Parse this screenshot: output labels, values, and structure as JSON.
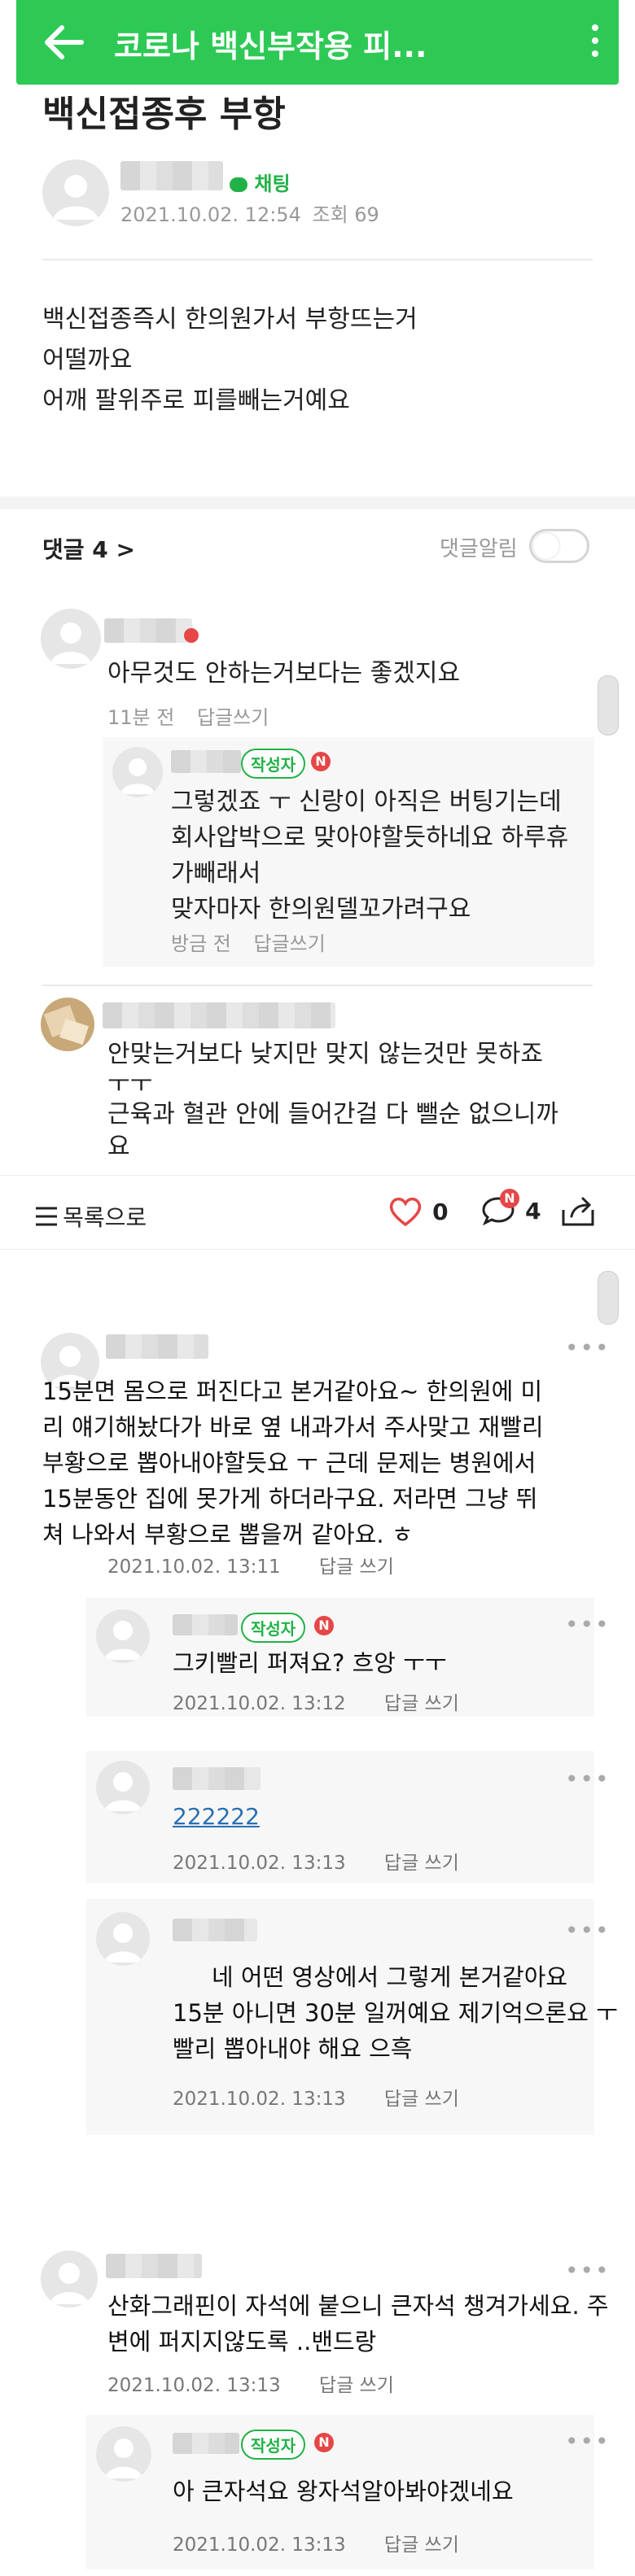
{
  "appbar": {
    "title": "코로나 백신부작용 피..."
  },
  "post": {
    "title": "백신접종후 부항",
    "chat_label": "채팅",
    "date": "2021.10.02. 12:54",
    "views": "조회 69",
    "lines": [
      "백신접종즉시 한의원가서 부항뜨는거",
      "어떨까요",
      "어깨 팔위주로 피를빼는거예요"
    ]
  },
  "comments_header": {
    "label": "댓글 4 >",
    "notify_label": "댓글알림"
  },
  "comments": [
    {
      "lines": [
        "아무것도 안하는거보다는 좋겠지요"
      ],
      "time": "11분 전",
      "reply": "답글쓰기"
    },
    {
      "author_badge": "작성자",
      "new": "N",
      "lines": [
        "그렇겠죠 ㅜ 신랑이 아직은 버팅기는데",
        "회사압박으로 맞아야할듯하네요 하루휴",
        "가빼래서",
        "맞자마자 한의원델꼬가려구요"
      ],
      "time": "방금 전",
      "reply": "답글쓰기"
    },
    {
      "lines": [
        "안맞는거보다 낮지만 맞지 않는것만 못하죠",
        "ㅜㅜ",
        "근육과 혈관 안에 들어간걸 다 뺄순 없으니까",
        "요"
      ]
    }
  ],
  "bottombar": {
    "list_label": "목록으로",
    "like_count": "0",
    "comment_count": "4",
    "new": "N"
  },
  "thread2": [
    {
      "lines": [
        "15분면 몸으로 퍼진다고 본거같아요~ 한의원에 미",
        "리 얘기해놨다가 바로 옆 내과가서 주사맞고 재빨리",
        "부황으로 뽑아내야할듯요 ㅜ 근데 문제는 병원에서",
        "15분동안 집에 못가게 하더라구요. 저라면 그냥 뛰",
        "쳐 나와서 부황으로 뽑을꺼 같아요. ㅎ"
      ],
      "date": "2021.10.02. 13:11",
      "reply": "답글 쓰기"
    },
    {
      "author_badge": "작성자",
      "new": "N",
      "lines": [
        "그키빨리 퍼져요? 흐앙 ㅜㅜ"
      ],
      "date": "2021.10.02. 13:12",
      "reply": "답글 쓰기"
    },
    {
      "link": "222222",
      "date": "2021.10.02. 13:13",
      "reply": "답글 쓰기"
    },
    {
      "lines": [
        "네 어떤 영상에서 그렇게 본거같아요",
        "15분 아니면 30분 일꺼예요 제기억으론요 ㅜ",
        "빨리 뽑아내야 해요 으흑"
      ],
      "date": "2021.10.02. 13:13",
      "reply": "답글 쓰기"
    },
    {
      "lines": [
        "산화그래핀이 자석에 붙으니 큰자석 챙겨가세요. 주",
        "변에 퍼지지않도록 ..밴드랑"
      ],
      "date": "2021.10.02. 13:13",
      "reply": "답글 쓰기"
    },
    {
      "author_badge": "작성자",
      "new": "N",
      "lines": [
        "아 큰자석요 왕자석알아봐야겠네요"
      ],
      "date": "2021.10.02. 13:13",
      "reply": "답글 쓰기"
    }
  ],
  "colors": {
    "brand": "#2ec955",
    "badge": "#21b247",
    "new_dot": "#e64646"
  },
  "icons": [
    "back-arrow-icon",
    "kebab-menu-icon",
    "chat-icon",
    "chevron-right-icon",
    "heart-icon",
    "comment-icon",
    "share-icon",
    "list-icon",
    "more-icon"
  ]
}
